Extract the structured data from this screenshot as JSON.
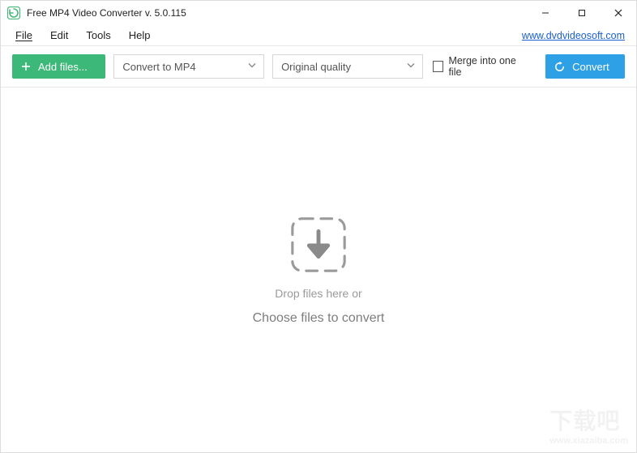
{
  "titlebar": {
    "title": "Free MP4 Video Converter v. 5.0.115"
  },
  "menubar": {
    "items": [
      "File",
      "Edit",
      "Tools",
      "Help"
    ],
    "site_link": "www.dvdvideosoft.com"
  },
  "toolbar": {
    "add_files_label": "Add files...",
    "format_dropdown": {
      "selected": "Convert to MP4"
    },
    "quality_dropdown": {
      "selected": "Original quality"
    },
    "merge_checkbox": {
      "label": "Merge into one file",
      "checked": false
    },
    "convert_label": "Convert"
  },
  "drop_area": {
    "line1": "Drop files here or",
    "line2": "Choose files to convert"
  },
  "icons": {
    "app": "app-logo-icon",
    "plus": "plus-icon",
    "refresh": "refresh-icon",
    "chevron_down": "chevron-down-icon",
    "download_arrow": "download-arrow-icon"
  }
}
